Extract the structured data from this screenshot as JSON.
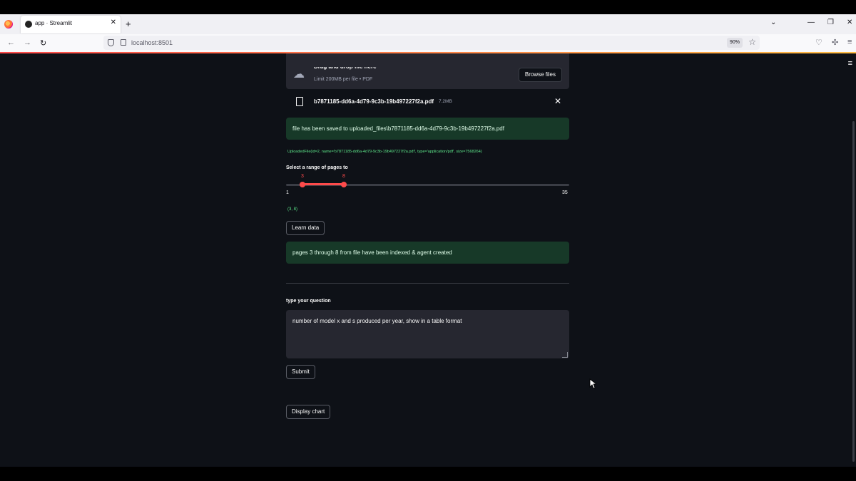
{
  "browser": {
    "tab_title": "app · Streamlit",
    "url": "localhost:8501",
    "zoom": "90%"
  },
  "uploader": {
    "drop_text": "Drag and drop file here",
    "limit_text": "Limit 200MB per file • PDF",
    "browse_label": "Browse files"
  },
  "file": {
    "name": "b7871185-dd6a-4d79-9c3b-19b497227f2a.pdf",
    "size": "7.2MB"
  },
  "saved_message": "file has been saved to uploaded_files\\b7871185-dd6a-4d79-9c3b-19b497227f2a.pdf",
  "uploaded_file_repr": "UploadedFile(id=2, name='b7871185-dd6a-4d79-9c3b-19b497227f2a.pdf', type='application/pdf', size=7568264)",
  "slider": {
    "label": "Select a range of pages to",
    "min": 1,
    "max": 35,
    "low": 3,
    "high": 8,
    "min_label": "1",
    "max_label": "35",
    "low_label": "3",
    "high_label": "8",
    "output": "(3, 8)"
  },
  "learn_button": "Learn data",
  "indexed_message": "pages 3 through 8 from file have been indexed & agent created",
  "question": {
    "label": "type your question",
    "value": "number of model x and s produced per year, show in a table format"
  },
  "submit_button": "Submit",
  "display_chart_button": "Display chart",
  "colors": {
    "background": "#0e1117",
    "primary": "#ff4b4b",
    "success_bg": "#173928",
    "widget_bg": "#262730"
  }
}
